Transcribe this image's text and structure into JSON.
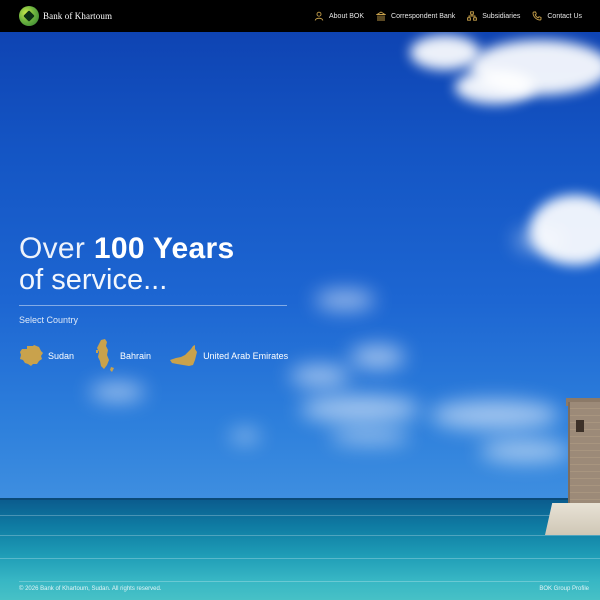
{
  "brand": {
    "name": "Bank of Khartoum",
    "logo_icon": "bok-logo-icon"
  },
  "nav": {
    "items": [
      {
        "label": "About BOK",
        "icon": "user-icon"
      },
      {
        "label": "Correspondent Bank",
        "icon": "bank-icon"
      },
      {
        "label": "Subsidiaries",
        "icon": "network-icon"
      },
      {
        "label": "Contact Us",
        "icon": "phone-icon"
      }
    ]
  },
  "hero": {
    "over": "Over",
    "years": "100 Years",
    "service": "of service..."
  },
  "country_selector": {
    "label": "Select Country",
    "countries": [
      {
        "label": "Sudan",
        "icon": "sudan-map-icon"
      },
      {
        "label": "Bahrain",
        "icon": "bahrain-map-icon"
      },
      {
        "label": "United Arab Emirates",
        "icon": "uae-map-icon"
      }
    ]
  },
  "footer": {
    "copyright": "© 2026 Bank of Khartoum, Sudan. All rights reserved.",
    "profile_link": "BOK Group Profile"
  },
  "colors": {
    "header_bg": "#000000",
    "map_icon_gold": "#c9a24c",
    "text": "#ffffff"
  }
}
